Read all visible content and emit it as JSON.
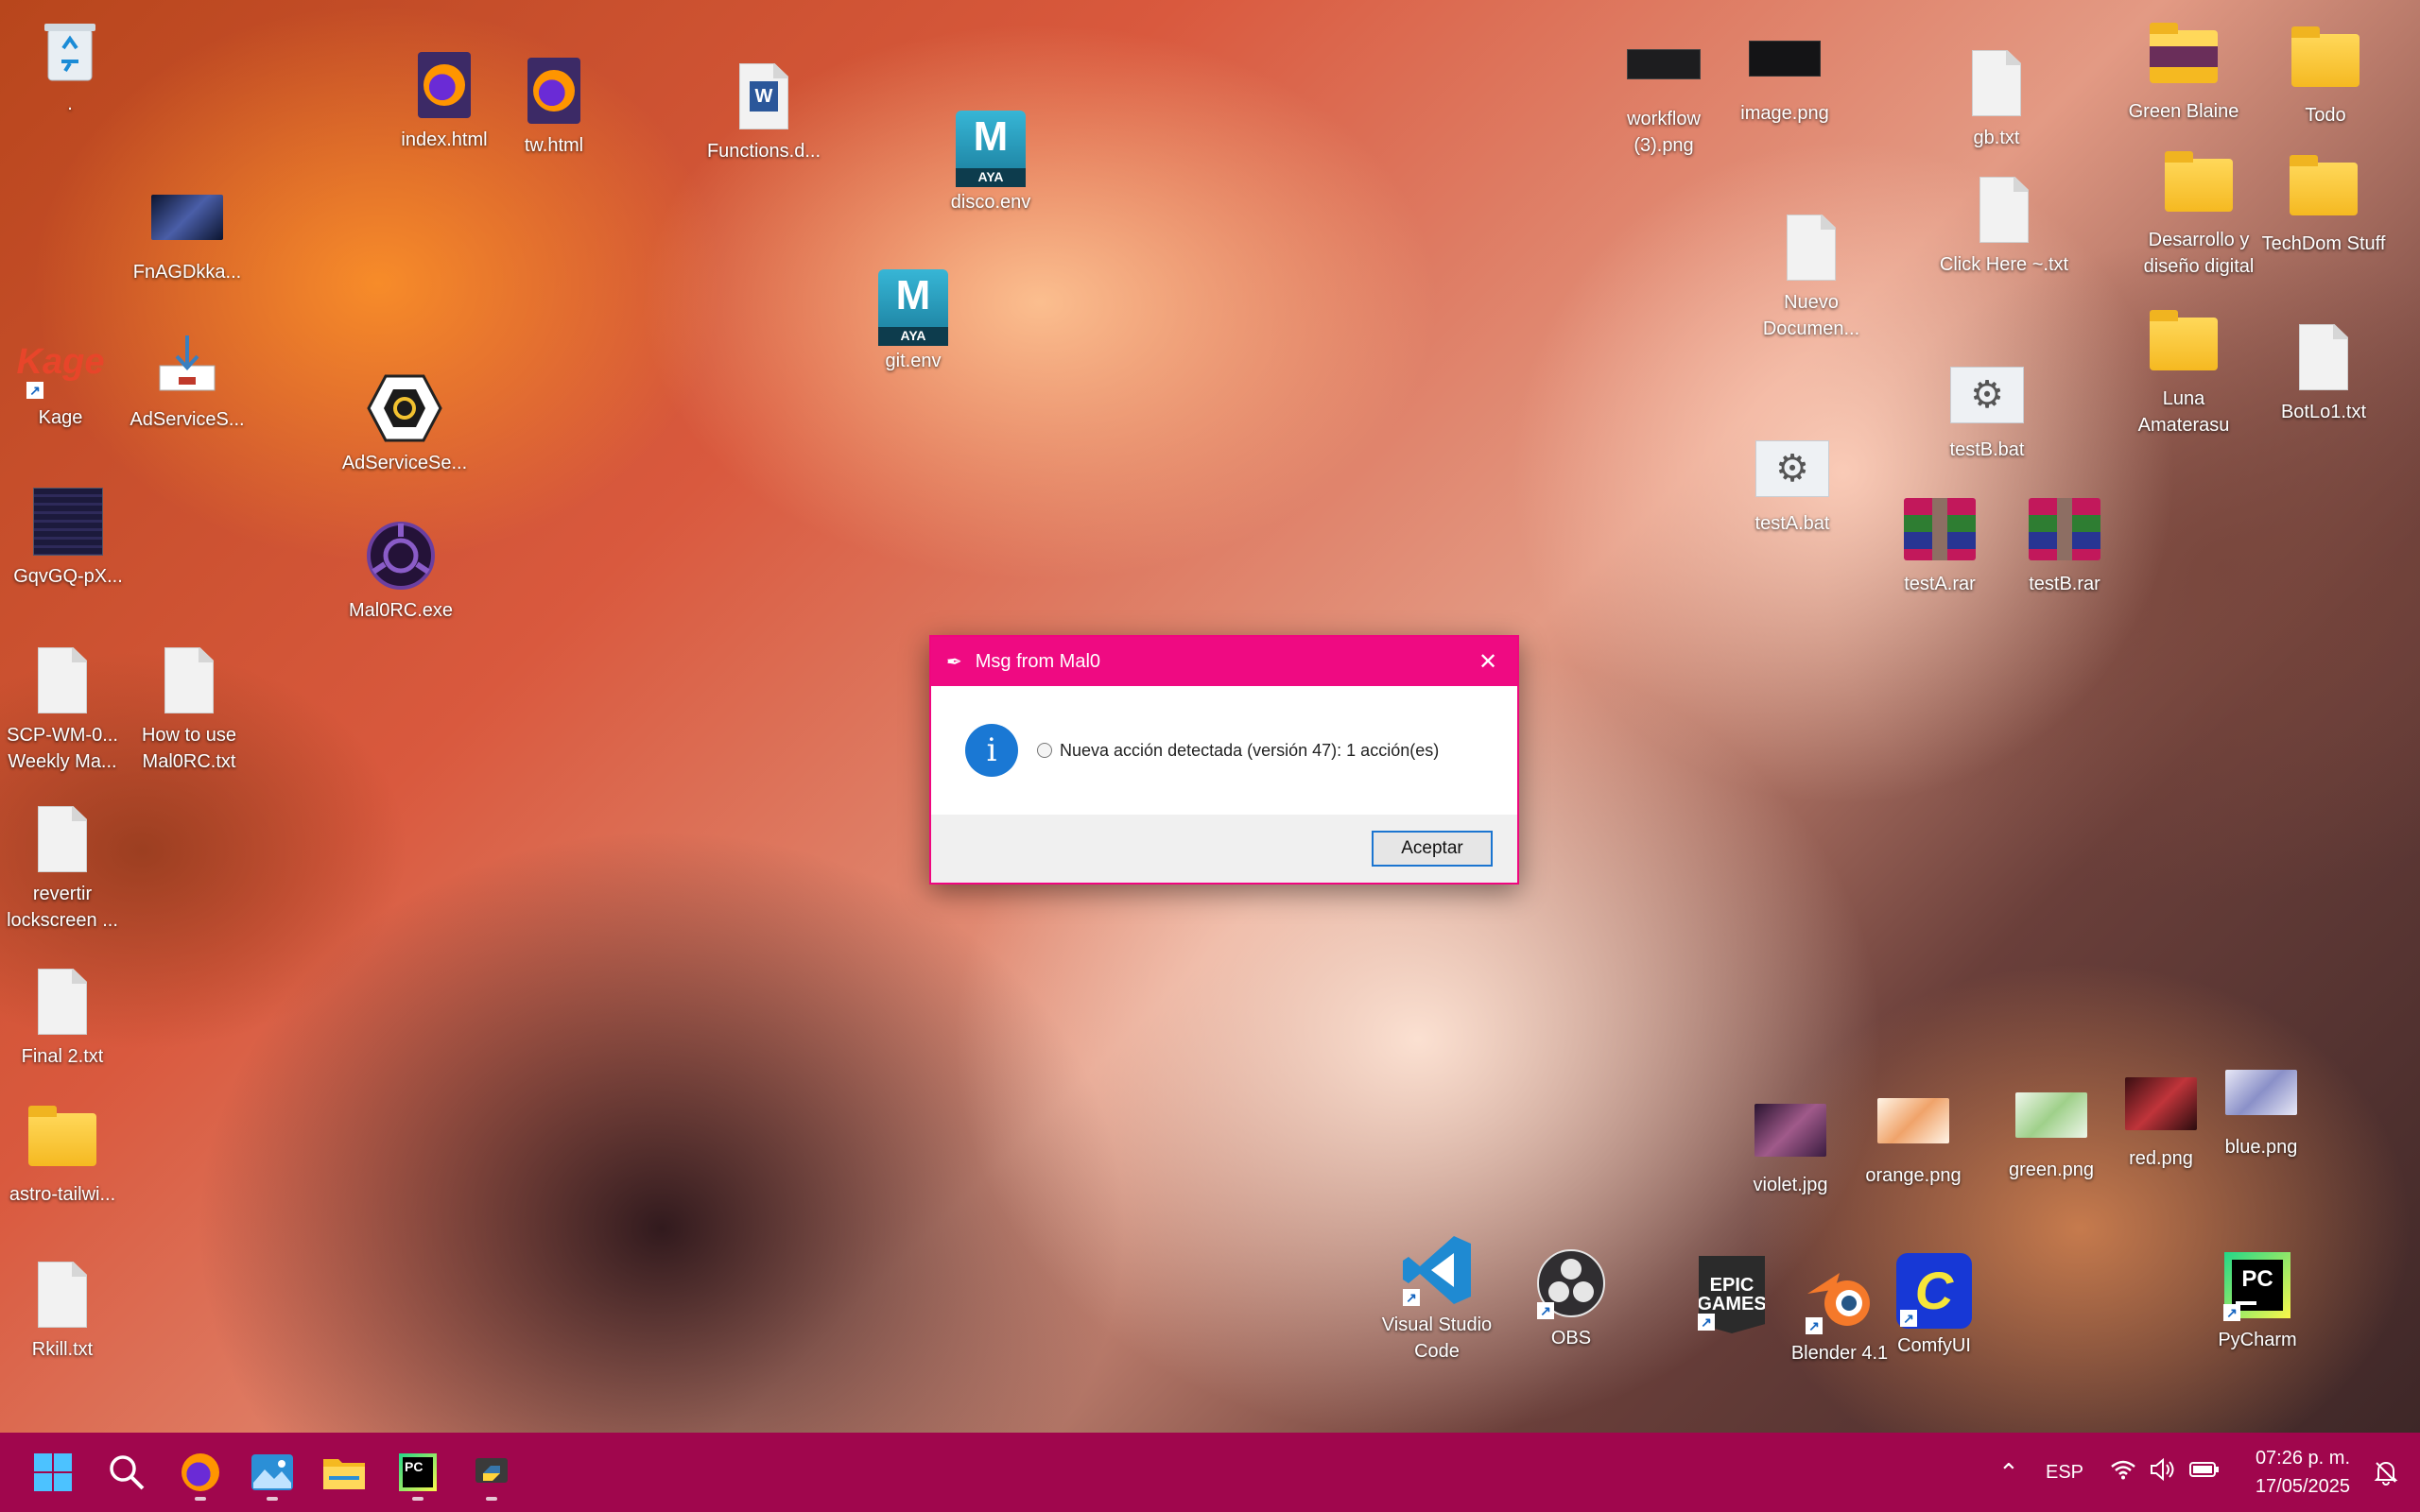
{
  "desktop": {
    "icons": {
      "recycle_bin": ".",
      "index_html": "index.html",
      "tw_html": "tw.html",
      "functions": "Functions.d...",
      "disco_env": "disco.env",
      "git_env": "git.env",
      "fnagd": "FnAGDkka...",
      "kage": "Kage",
      "adservices1": "AdServiceS...",
      "adservicese": "AdServiceSe...",
      "gqvgq": "GqvGQ-pX...",
      "malorc": "Mal0RC.exe",
      "scp": "SCP-WM-0... Weekly Ma...",
      "howto": "How to use Mal0RC.txt",
      "revertir": "revertir lockscreen ...",
      "final2": "Final 2.txt",
      "astro": "astro-tailwi...",
      "rkill": "Rkill.txt",
      "workflow": "workflow (3).png",
      "image_png": "image.png",
      "gb_txt": "gb.txt",
      "green_blaine": "Green Blaine",
      "todo": "Todo",
      "nuevo_doc": "Nuevo Documen...",
      "click_here": "Click Here ~.txt",
      "desarrollo": "Desarrollo y diseño digital",
      "techdom": "TechDom Stuff",
      "testb_bat": "testB.bat",
      "testa_bat": "testA.bat",
      "luna": "Luna Amaterasu",
      "botlo": "BotLo1.txt",
      "testa_rar": "testA.rar",
      "testb_rar": "testB.rar",
      "violet": "violet.jpg",
      "orange": "orange.png",
      "green": "green.png",
      "red": "red.png",
      "blue": "blue.png",
      "vscode": "Visual Studio Code",
      "obs": "OBS",
      "epic": "",
      "blender": "Blender 4.1",
      "comfy": "ComfyUI",
      "pycharm": "PyCharm",
      "kage_logo_text": "Kage",
      "epic_logo_text": "EPIC GAMES",
      "maya_badge": "AYA"
    }
  },
  "dialog": {
    "title": "Msg from Mal0",
    "message": "Nueva acción detectada (versión 47): 1 acción(es)",
    "ok_label": "Aceptar"
  },
  "taskbar": {
    "language": "ESP",
    "time": "07:26 p. m.",
    "date": "17/05/2025"
  },
  "colors": {
    "taskbar": "#a0064d",
    "dialog_title": "#ef0a82"
  }
}
